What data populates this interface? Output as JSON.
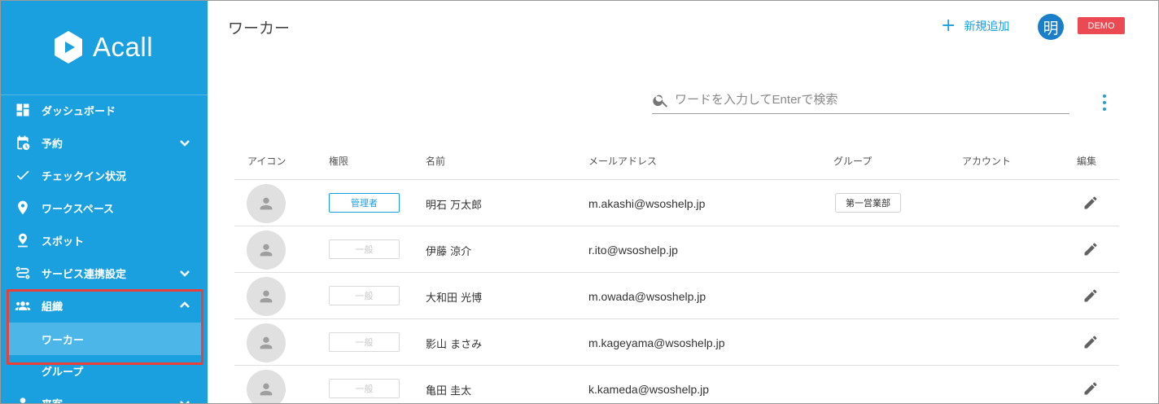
{
  "brand": {
    "name": "Acall"
  },
  "sidebar": {
    "items": [
      {
        "label": "ダッシュボード",
        "icon": "dashboard-icon"
      },
      {
        "label": "予約",
        "icon": "calendar-clock-icon",
        "chevron": "down"
      },
      {
        "label": "チェックイン状況",
        "icon": "check-icon"
      },
      {
        "label": "ワークスペース",
        "icon": "map-pin-icon"
      },
      {
        "label": "スポット",
        "icon": "person-pin-icon"
      },
      {
        "label": "サービス連携設定",
        "icon": "integration-icon",
        "chevron": "down"
      },
      {
        "label": "組織",
        "icon": "people-icon",
        "chevron": "up"
      },
      {
        "label": "ワーカー",
        "sub": true,
        "active": true
      },
      {
        "label": "グループ",
        "sub": true
      },
      {
        "label": "来客",
        "icon": "visitor-icon",
        "chevron": "down"
      }
    ]
  },
  "header": {
    "title": "ワーカー",
    "add_label": "新規追加",
    "user_avatar": "明",
    "env_badge": "DEMO"
  },
  "search": {
    "placeholder": "ワードを入力してEnterで検索"
  },
  "table": {
    "columns": [
      "アイコン",
      "権限",
      "名前",
      "メールアドレス",
      "グループ",
      "アカウント",
      "編集"
    ],
    "rows": [
      {
        "role": "管理者",
        "role_type": "admin",
        "name": "明石 万太郎",
        "email": "m.akashi@wsoshelp.jp",
        "group": "第一営業部"
      },
      {
        "role": "一般",
        "role_type": "general",
        "name": "伊藤 涼介",
        "email": "r.ito@wsoshelp.jp",
        "group": ""
      },
      {
        "role": "一般",
        "role_type": "general",
        "name": "大和田 光博",
        "email": "m.owada@wsoshelp.jp",
        "group": ""
      },
      {
        "role": "一般",
        "role_type": "general",
        "name": "影山 まさみ",
        "email": "m.kageyama@wsoshelp.jp",
        "group": ""
      },
      {
        "role": "一般",
        "role_type": "general",
        "name": "亀田 圭太",
        "email": "k.kameda@wsoshelp.jp",
        "group": ""
      }
    ]
  },
  "colors": {
    "sidebar": "#1a9fdf",
    "accent": "#1a9fdf",
    "highlight": "#e8413b",
    "demo": "#ec4a52"
  }
}
